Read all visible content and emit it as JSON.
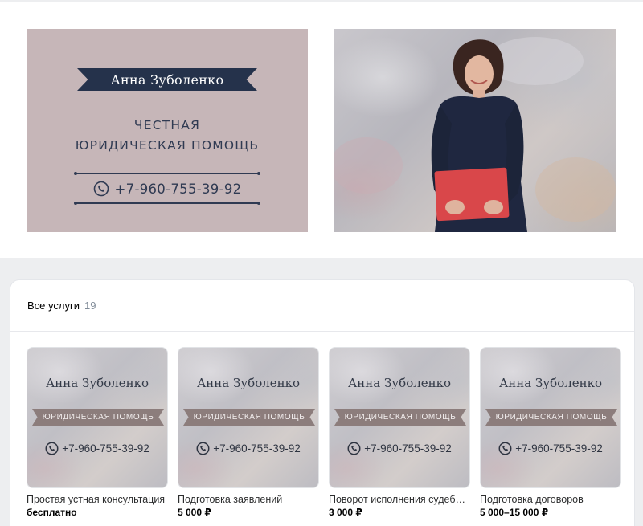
{
  "cover": {
    "name": "Анна Зуболенко",
    "tagline_line1": "ЧЕСТНАЯ",
    "tagline_line2": "ЮРИДИЧЕСКАЯ ПОМОЩЬ",
    "phone": "+7-960-755-39-92",
    "phone_icon": "phone-icon",
    "colors": {
      "card_bg": "#c6b6b8",
      "ribbon": "#25324b"
    }
  },
  "services": {
    "title": "Все услуги",
    "count": "19",
    "items": [
      {
        "card_name": "Анна Зуболенко",
        "card_band": "ЮРИДИЧЕСКАЯ ПОМОЩЬ",
        "card_phone": "+7-960-755-39-92",
        "name": "Простая устная консультация",
        "price": "бесплатно"
      },
      {
        "card_name": "Анна Зуболенко",
        "card_band": "ЮРИДИЧЕСКАЯ ПОМОЩЬ",
        "card_phone": "+7-960-755-39-92",
        "name": "Подготовка заявлений",
        "price": "5 000 ₽"
      },
      {
        "card_name": "Анна Зуболенко",
        "card_band": "ЮРИДИЧЕСКАЯ ПОМОЩЬ",
        "card_phone": "+7-960-755-39-92",
        "name": "Поворот исполнения судебного решения",
        "price": "3 000 ₽"
      },
      {
        "card_name": "Анна Зуболенко",
        "card_band": "ЮРИДИЧЕСКАЯ ПОМОЩЬ",
        "card_phone": "+7-960-755-39-92",
        "name": "Подготовка договоров",
        "price": "5 000–15 000 ₽"
      }
    ]
  }
}
